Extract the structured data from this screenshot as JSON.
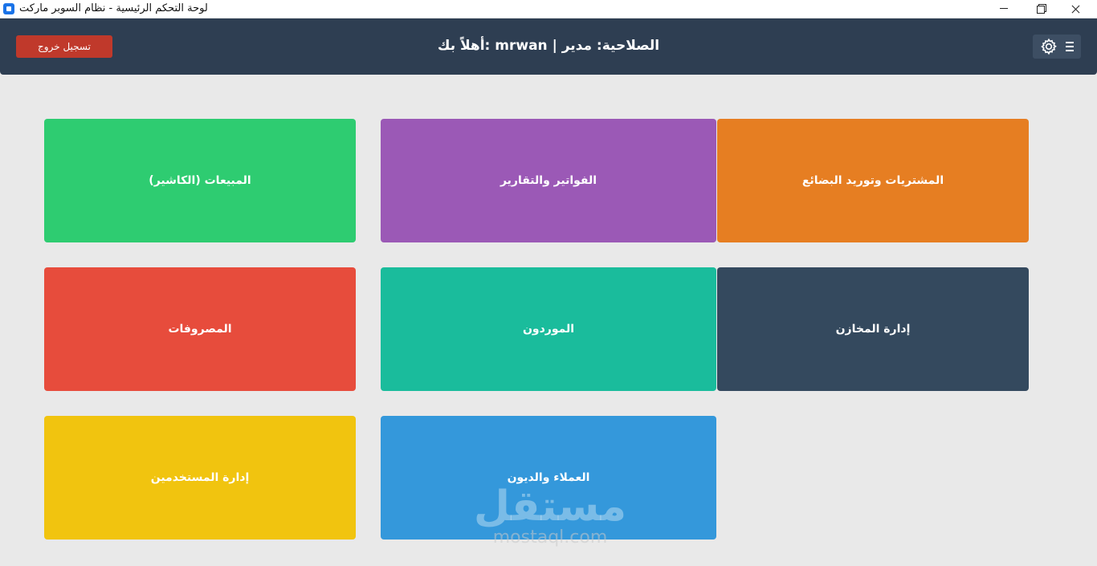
{
  "window": {
    "title": "لوحة التحكم الرئيسية - نظام السوبر ماركت"
  },
  "header": {
    "welcome": "الصلاحية: مدير | mrwan :أهلاً بك",
    "logout_label": "تسجيل خروج",
    "settings_icon": "gear-icon",
    "menu_icon": "hamburger-menu-icon"
  },
  "cards": [
    {
      "label": "المشتريات وتوريد البضائع",
      "color": "#e67e22"
    },
    {
      "label": "الفواتير والتقارير",
      "color": "#9b59b6"
    },
    {
      "label": "المبيعات (الكاشير)",
      "color": "#2ecc71"
    },
    {
      "label": "إدارة المخازن",
      "color": "#34495e"
    },
    {
      "label": "الموردون",
      "color": "#1abc9c"
    },
    {
      "label": "المصروفات",
      "color": "#e74c3c"
    },
    {
      "label": "العملاء والديون",
      "color": "#3498db"
    },
    {
      "label": "إدارة المستخدمين",
      "color": "#f1c40f"
    }
  ],
  "watermark": {
    "arabic": "مستقل",
    "latin": "mostaql.com"
  }
}
